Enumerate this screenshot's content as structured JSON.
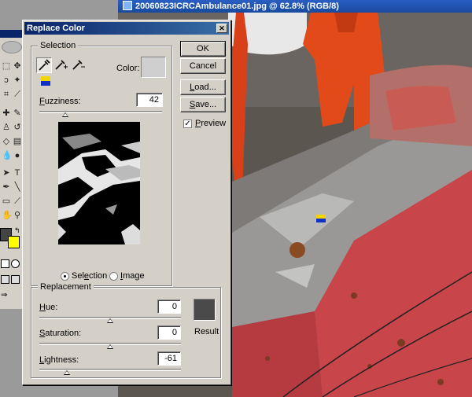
{
  "document": {
    "title": "20060823ICRCAmbulance01.jpg @ 62.8% (RGB/8)"
  },
  "dialog": {
    "title": "Replace Color",
    "selection_group": {
      "label": "Selection",
      "color_label": "Color:",
      "color_value": "#cfcfcf",
      "fuzziness_label": "Fuzziness:",
      "fuzziness_value": "42",
      "fuzziness_fraction": 0.21,
      "view_options": [
        {
          "label": "Selection",
          "checked": true
        },
        {
          "label": "Image",
          "checked": false
        }
      ]
    },
    "buttons": {
      "ok": "OK",
      "cancel": "Cancel",
      "load": "Load...",
      "save": "Save..."
    },
    "preview": {
      "label": "Preview",
      "checked": true,
      "mark": "✓"
    },
    "replacement_group": {
      "label": "Replacement",
      "hue_label": "Hue:",
      "hue_value": "0",
      "hue_fraction": 0.5,
      "saturation_label": "Saturation:",
      "saturation_value": "0",
      "saturation_fraction": 0.5,
      "lightness_label": "Lightness:",
      "lightness_value": "-61",
      "lightness_fraction": 0.195,
      "result_label": "Result",
      "result_color": "#4a4a4a"
    }
  },
  "toolbox": {
    "foreground_color": "#444444",
    "background_color": "#ffff00",
    "icons": [
      "marquee-icon",
      "lasso-icon",
      "crop-icon",
      "heal-icon",
      "brush-icon",
      "stamp-icon",
      "history-brush-icon",
      "eraser-icon",
      "gradient-icon",
      "blur-icon",
      "dodge-icon",
      "path-select-icon",
      "type-icon",
      "pen-icon",
      "shape-icon",
      "notes-icon",
      "eyedropper-icon",
      "hand-icon",
      "zoom-icon"
    ]
  }
}
